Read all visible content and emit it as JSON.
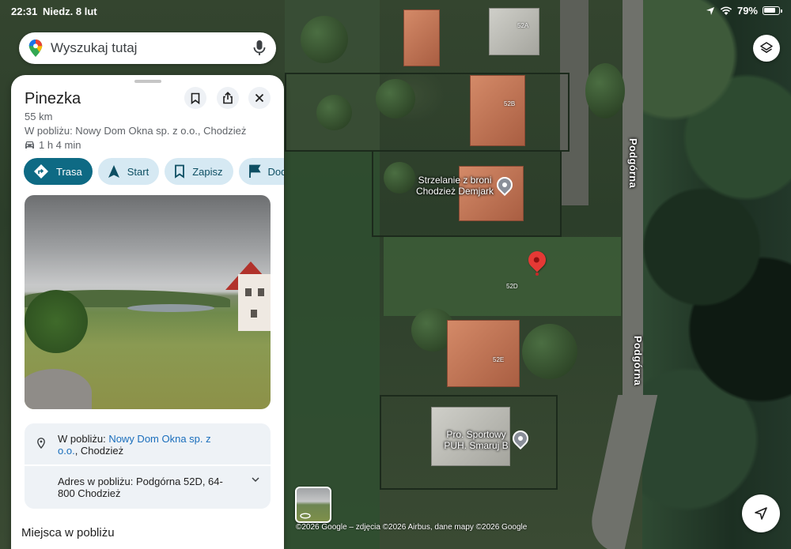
{
  "status_bar": {
    "time": "22:31",
    "date": "Niedz. 8 lut",
    "battery": "79%"
  },
  "search": {
    "placeholder": "Wyszukaj tutaj"
  },
  "place_panel": {
    "title": "Pinezka",
    "distance": "55 km",
    "nearby_text": "W pobliżu: Nowy Dom Okna sp. z o.o., Chodzież",
    "drive_time": "1 h 4 min",
    "actions": [
      {
        "label": "Trasa",
        "icon": "directions-icon"
      },
      {
        "label": "Start",
        "icon": "navigation-arrow-icon"
      },
      {
        "label": "Zapisz",
        "icon": "bookmark-icon"
      },
      {
        "label": "Dodaj",
        "icon": "flag-icon"
      }
    ],
    "info_nearby": {
      "prefix": "W pobliżu: ",
      "link": "Nowy Dom Okna sp. z o.o.",
      "suffix": ", Chodzież"
    },
    "address": "Adres w pobliżu: Podgórna 52D, 64-800 Chodzież",
    "nearby_places_title": "Miejsca w pobliżu"
  },
  "map": {
    "street_label": "Podgórna",
    "house_numbers": [
      "52A",
      "52B",
      "52D",
      "52E"
    ],
    "pois": [
      "Strzelanie z broni Chodzież Demjark",
      "Pro. Sportowy PUH. Smaruj B"
    ],
    "attribution": "©2026 Google – zdjęcia ©2026 Airbus, dane mapy ©2026 Google",
    "pin_color": "#e53935"
  }
}
